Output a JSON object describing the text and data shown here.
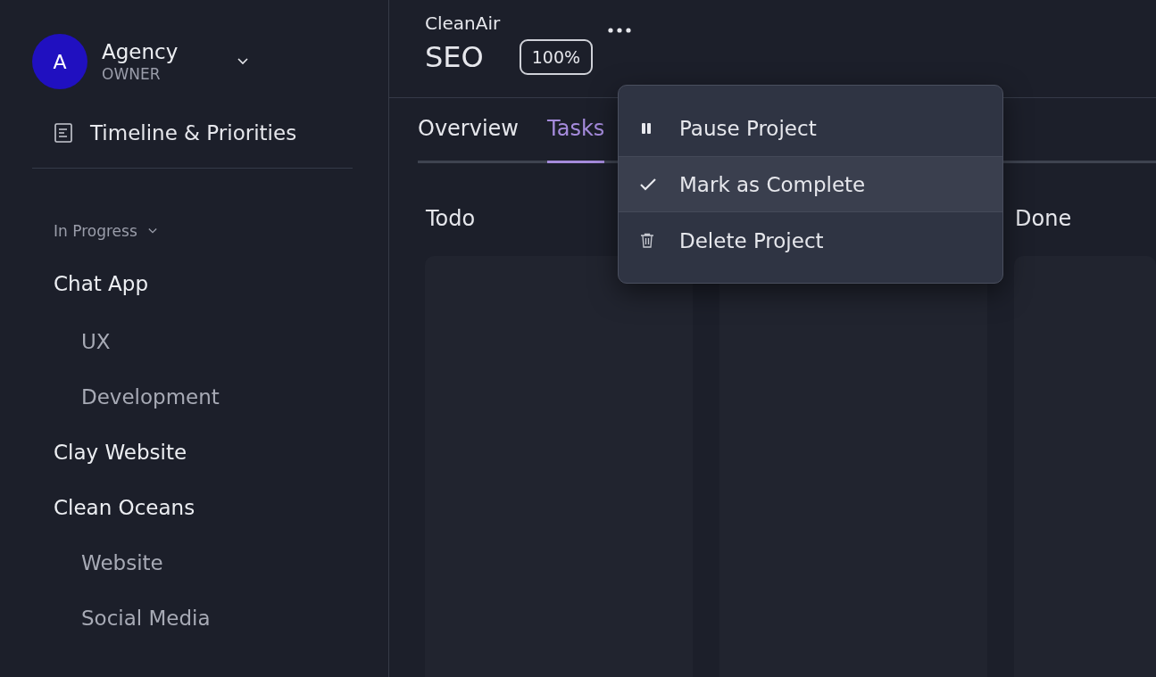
{
  "workspace": {
    "avatar_letter": "A",
    "name": "Agency",
    "role": "OWNER"
  },
  "nav": [
    {
      "label": "Timeline & Priorities"
    }
  ],
  "project_group": {
    "label": "In Progress",
    "expanded": true,
    "projects": [
      {
        "label": "Chat App",
        "children": [
          {
            "label": "UX"
          },
          {
            "label": "Development"
          }
        ]
      },
      {
        "label": "Clay Website"
      },
      {
        "label": "Clean Oceans",
        "children": [
          {
            "label": "Website"
          },
          {
            "label": "Social Media"
          }
        ]
      }
    ]
  },
  "header": {
    "client": "CleanAir",
    "project": "SEO",
    "progress": "100%"
  },
  "tabs": [
    {
      "label": "Overview",
      "selected": false
    },
    {
      "label": "Tasks",
      "selected": true
    }
  ],
  "board": {
    "columns": [
      {
        "title": "Todo"
      },
      {},
      {
        "title": "Done"
      }
    ]
  },
  "menu": {
    "items": [
      {
        "kind": "pause",
        "label": "Pause Project",
        "selected": false
      },
      {
        "kind": "check",
        "label": "Mark as Complete",
        "selected": true
      },
      {
        "kind": "trash",
        "label": "Delete Project",
        "selected": false
      }
    ]
  }
}
